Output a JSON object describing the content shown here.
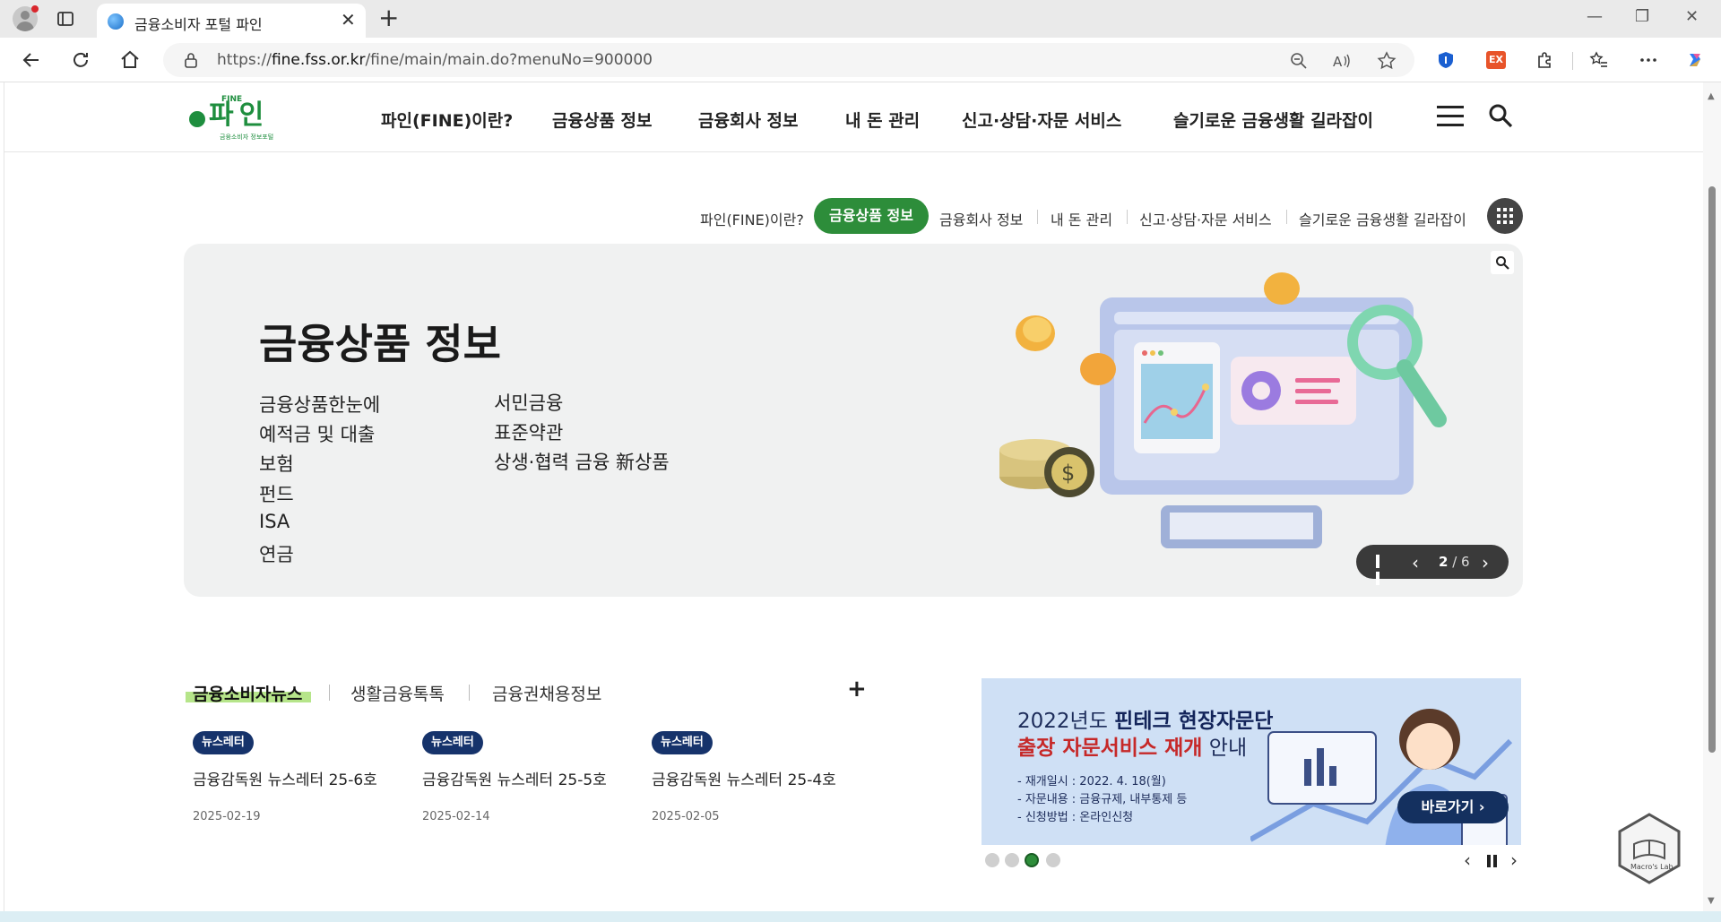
{
  "browser": {
    "tab_title": "금융소비자 포털 파인",
    "url_prefix": "https://",
    "url_host": "fine.fss.or.kr",
    "url_path": "/fine/main/main.do?menuNo=900000",
    "ext_badge": "EX"
  },
  "header": {
    "logo_tag": "FINE",
    "logo_name": "파인",
    "logo_sub": "금융소비자 정보포털",
    "nav": [
      "파인(FINE)이란?",
      "금융상품 정보",
      "금융회사 정보",
      "내 돈 관리",
      "신고·상담·자문 서비스",
      "슬기로운 금융생활 길라잡이"
    ]
  },
  "subnav": {
    "items": [
      "파인(FINE)이란?",
      "금융상품 정보",
      "금융회사 정보",
      "내 돈 관리",
      "신고·상담·자문 서비스",
      "슬기로운 금융생활 길라잡이"
    ],
    "active": "금융상품 정보"
  },
  "hero": {
    "title": "금융상품 정보",
    "links_col1": [
      "금융상품한눈에",
      "예적금 및 대출",
      "보험",
      "펀드",
      "ISA",
      "연금"
    ],
    "links_col2": [
      "서민금융",
      "표준약관",
      "상생·협력 금융 新상품"
    ],
    "slide_current": "2",
    "slide_total": "6"
  },
  "news": {
    "tabs": [
      "금융소비자뉴스",
      "생활금융톡톡",
      "금융권채용정보"
    ],
    "more": "+",
    "cards": [
      {
        "badge": "뉴스레터",
        "title": "금융감독원 뉴스레터 25-6호",
        "date": "2025-02-19"
      },
      {
        "badge": "뉴스레터",
        "title": "금융감독원 뉴스레터 25-5호",
        "date": "2025-02-14"
      },
      {
        "badge": "뉴스레터",
        "title": "금융감독원 뉴스레터 25-4호",
        "date": "2025-02-05"
      }
    ]
  },
  "banner": {
    "line1_pre": "2022년도 ",
    "line1_bold": "핀테크 현장자문단",
    "line2_red": "출장 자문서비스 재개",
    "line2_post": " 안내",
    "bullets": [
      "- 재개일시 : 2022. 4. 18(월)",
      "- 자문내용 : 금융규제, 내부통제 등",
      "- 신청방법 : 온라인신청"
    ],
    "button": "바로가기 ›",
    "active_dot": 3
  },
  "macro_label": "Macro's Lab",
  "colors": {
    "brand_green": "#2d8d3a",
    "navy": "#16336b",
    "highlight": "#b6e58a"
  }
}
